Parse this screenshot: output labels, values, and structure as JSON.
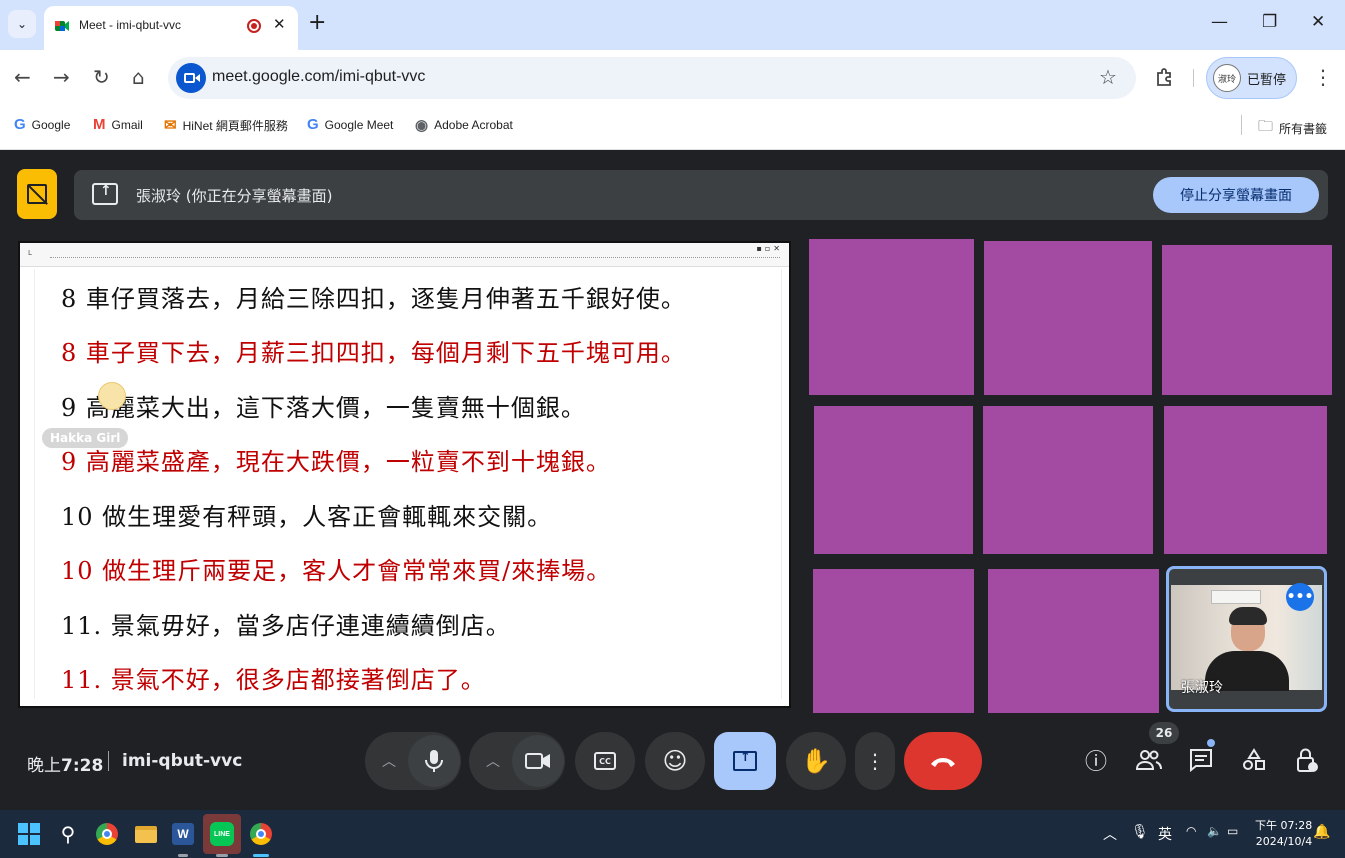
{
  "browser": {
    "tab_title": "Meet - imi-qbut-vvc",
    "url": "meet.google.com/imi-qbut-vvc",
    "profile_name": "淑玲",
    "profile_status": "已暫停",
    "bookmarks": [
      {
        "label": "Google",
        "icon": "google-icon"
      },
      {
        "label": "Gmail",
        "icon": "gmail-icon"
      },
      {
        "label": "HiNet 網頁郵件服務",
        "icon": "mail-icon"
      },
      {
        "label": "Google Meet",
        "icon": "google-icon"
      },
      {
        "label": "Adobe Acrobat",
        "icon": "acrobat-icon"
      }
    ],
    "all_bookmarks": "所有書籤"
  },
  "meet": {
    "share_banner": "張淑玲 (你正在分享螢幕畫面)",
    "stop_share": "停止分享螢幕畫面",
    "time_prefix": "晚上",
    "time": "7:28",
    "meeting_code": "imi-qbut-vvc",
    "participants_count": "26",
    "self_name": "張淑玲",
    "self_more": "•••",
    "tile_color": "#a34aa2",
    "presenting_label": "Hakka Girl"
  },
  "document": {
    "lines": [
      {
        "text": "8  車仔買落去，月給三除四扣，逐隻月伸著五千銀好使。",
        "color": "black"
      },
      {
        "text": "8 車子買下去，月薪三扣四扣，每個月剩下五千塊可用。",
        "color": "red"
      },
      {
        "text": "9   高麗菜大出，這下落大價，一隻賣無十個銀。",
        "color": "black"
      },
      {
        "text": "9 高麗菜盛產，現在大跌價，一粒賣不到十塊銀。",
        "color": "red"
      },
      {
        "text": "10 做生理愛有秤頭，人客正會輒輒來交關。",
        "color": "black"
      },
      {
        "text": "10 做生理斤兩要足，客人才會常常來買/來捧場。",
        "color": "red"
      },
      {
        "text": "11. 景氣毋好，當多店仔連連續續倒店。",
        "color": "black"
      },
      {
        "text": "11. 景氣不好，很多店都接著倒店了。",
        "color": "red"
      }
    ]
  },
  "taskbar": {
    "ime": "英",
    "time": "下午 07:28",
    "date": "2024/10/4"
  }
}
